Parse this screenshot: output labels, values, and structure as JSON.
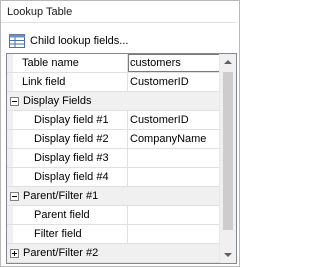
{
  "panel": {
    "title": "Lookup Table"
  },
  "toolbar": {
    "child_fields_label": "Child lookup fields...",
    "child_fields_icon": "table-grid-icon"
  },
  "grid": {
    "rows": [
      {
        "name": "Table name",
        "value": "customers"
      },
      {
        "name": "Link field",
        "value": "CustomerID"
      }
    ],
    "display_fields": {
      "label": "Display Fields",
      "rows": [
        {
          "name": "Display field #1",
          "value": "CustomerID"
        },
        {
          "name": "Display field #2",
          "value": "CompanyName"
        },
        {
          "name": "Display field #3",
          "value": ""
        },
        {
          "name": "Display field #4",
          "value": ""
        }
      ]
    },
    "parent_filter_1": {
      "label": "Parent/Filter #1",
      "rows": [
        {
          "name": "Parent field",
          "value": ""
        },
        {
          "name": "Filter field",
          "value": ""
        }
      ]
    },
    "parent_filter_2": {
      "label": "Parent/Filter #2"
    }
  }
}
